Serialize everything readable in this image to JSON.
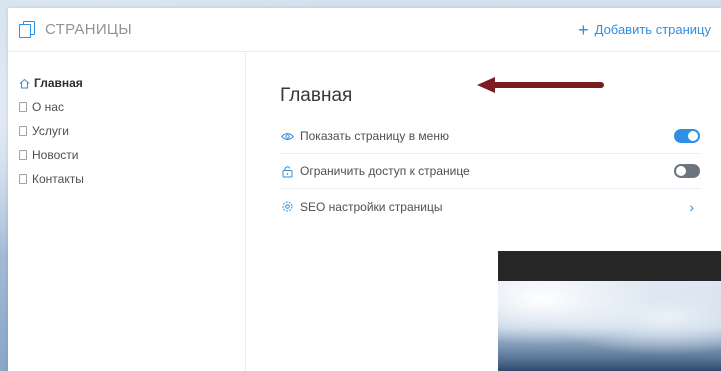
{
  "header": {
    "title": "СТРАНИЦЫ",
    "add_page_label": "Добавить страницу",
    "accent_color": "#2f8fe2"
  },
  "sidebar": {
    "items": [
      {
        "label": "Главная",
        "icon": "home-icon",
        "active": true
      },
      {
        "label": "О нас",
        "icon": "page-icon",
        "active": false
      },
      {
        "label": "Услуги",
        "icon": "page-icon",
        "active": false
      },
      {
        "label": "Новости",
        "icon": "page-icon",
        "active": false
      },
      {
        "label": "Контакты",
        "icon": "page-icon",
        "active": false
      }
    ]
  },
  "main": {
    "heading": "Главная",
    "settings": [
      {
        "label": "Показать страницу в меню",
        "icon": "eye-icon",
        "control": "toggle",
        "state": "on"
      },
      {
        "label": "Ограничить доступ к странице",
        "icon": "lock-icon",
        "control": "toggle",
        "state": "off"
      },
      {
        "label": "SEO настройки страницы",
        "icon": "gear-icon",
        "control": "chevron"
      }
    ]
  },
  "annotation": {
    "type": "arrow",
    "color": "#7b1e22"
  }
}
